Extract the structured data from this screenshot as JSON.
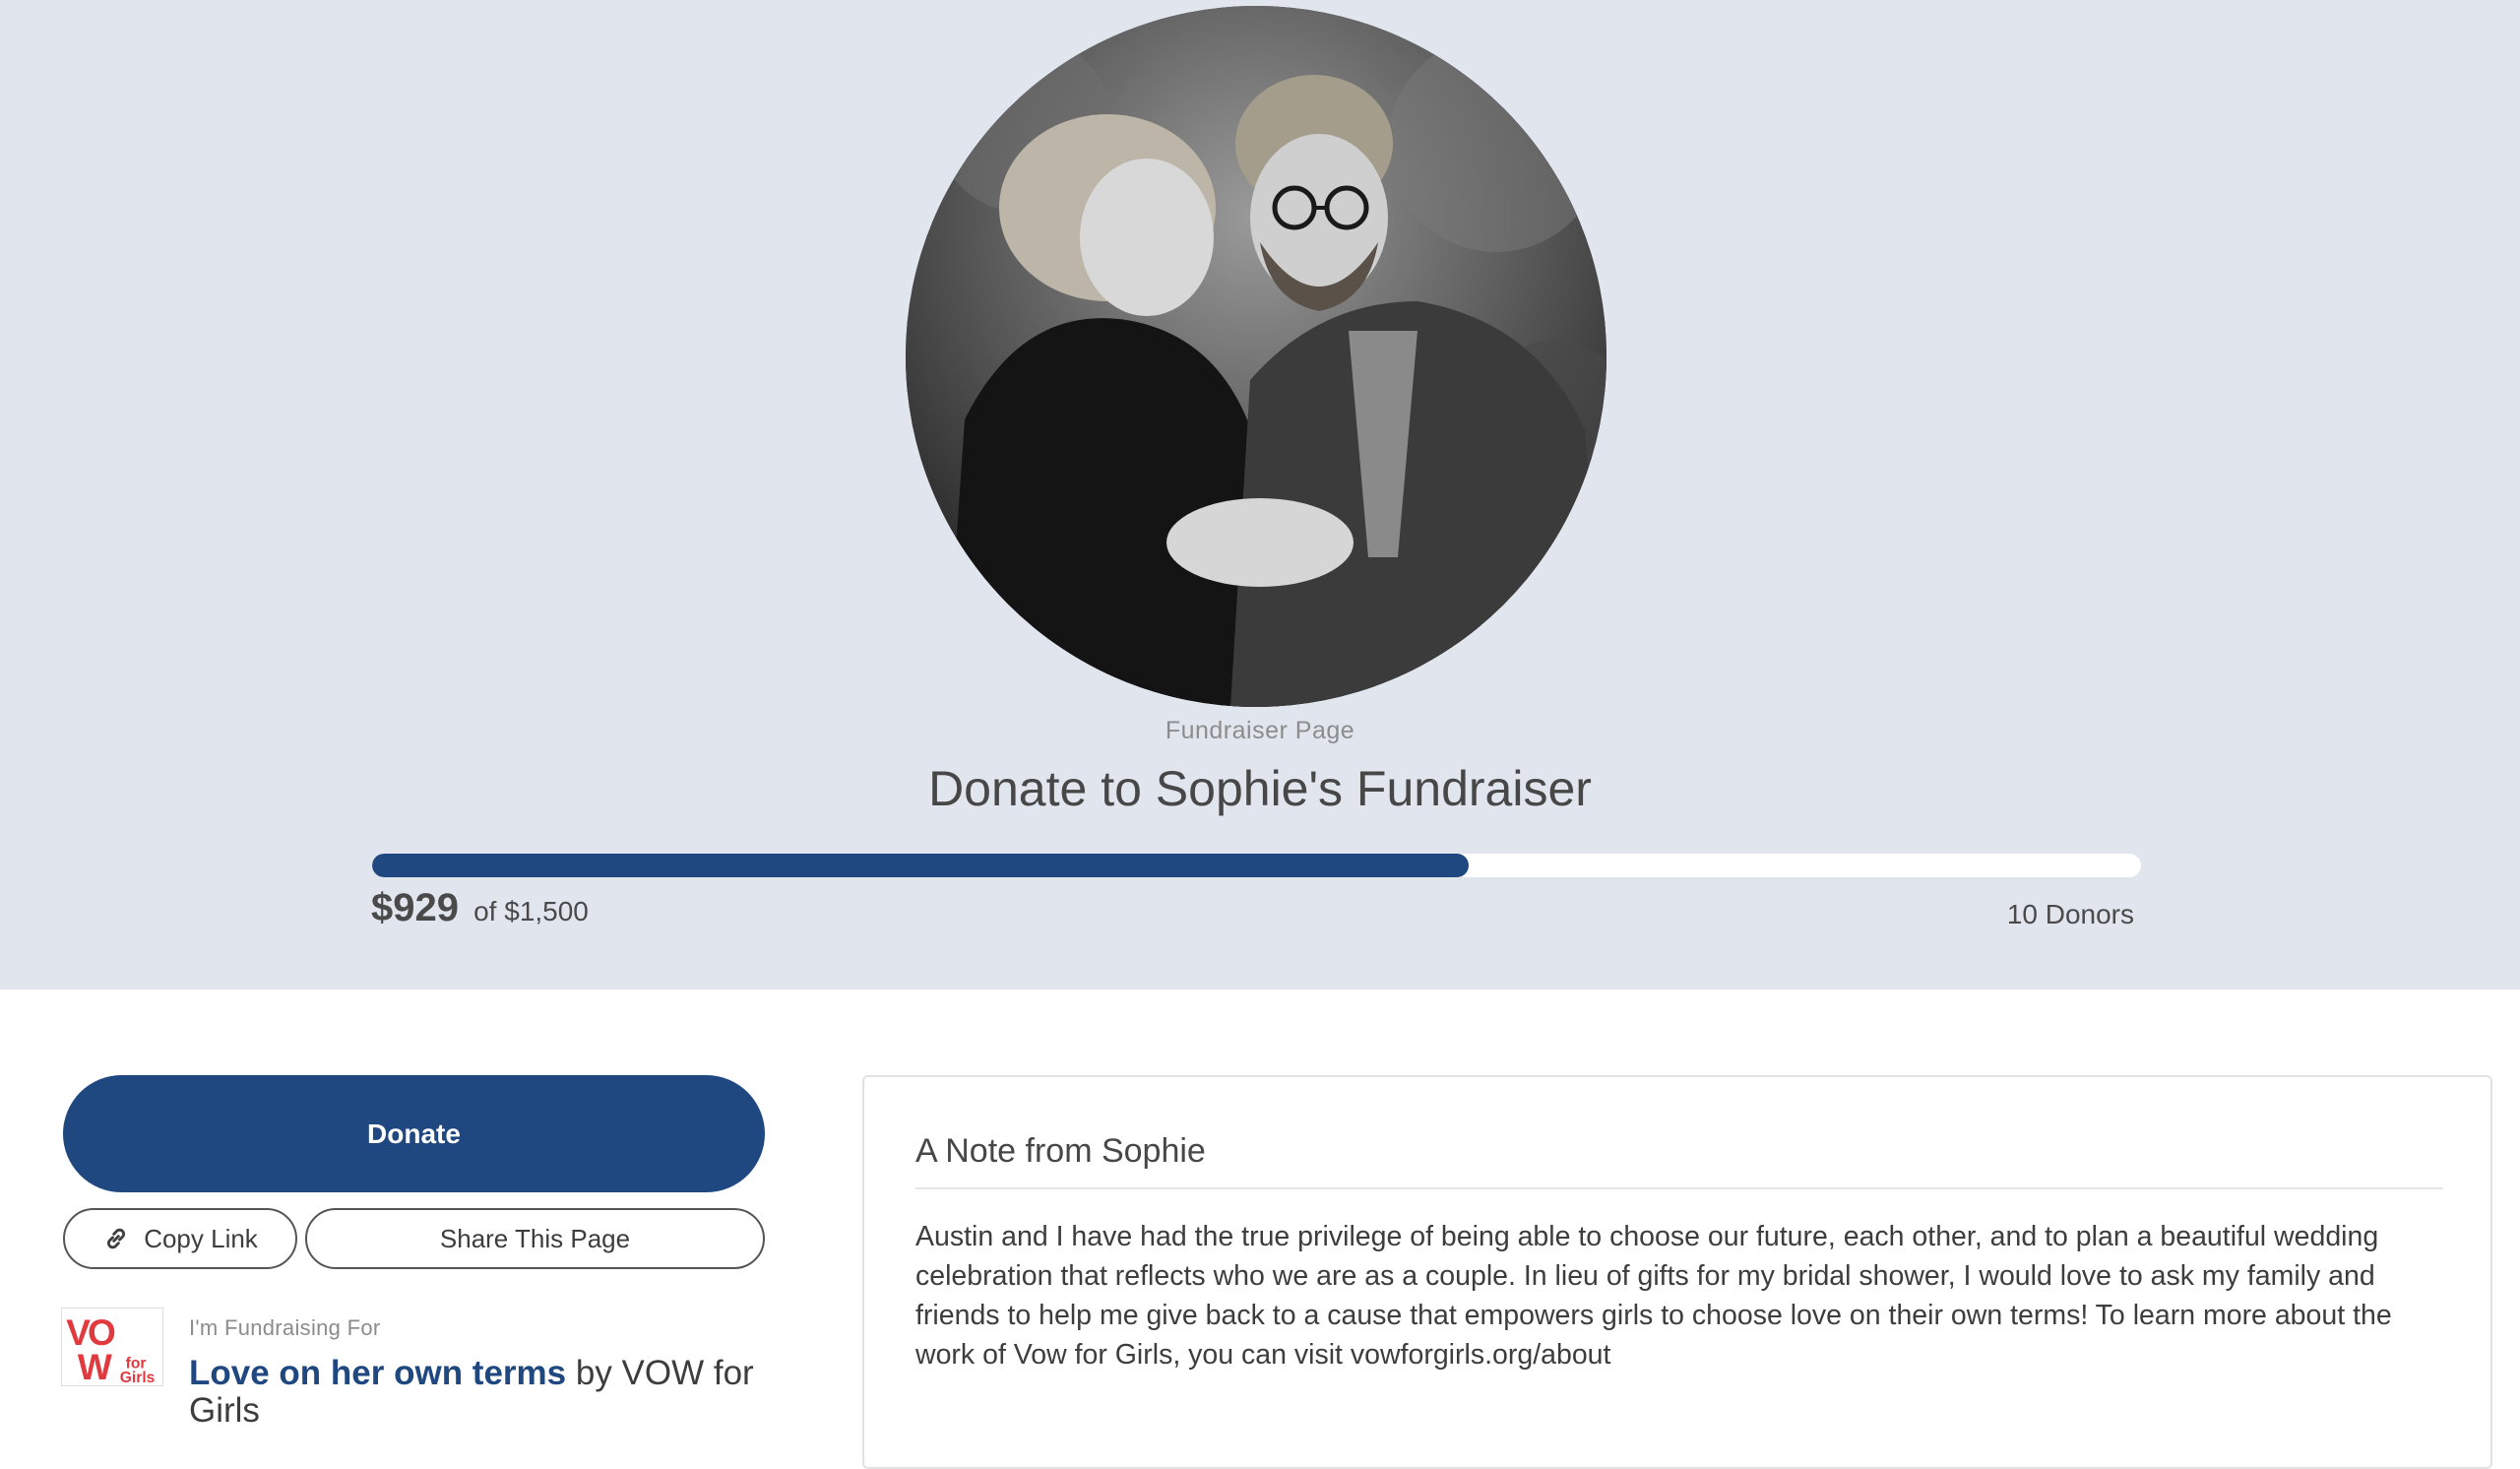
{
  "hero": {
    "eyebrow": "Fundraiser Page",
    "title": "Donate to Sophie's Fundraiser",
    "progress": {
      "raised": "$929",
      "goal_text": "of $1,500",
      "fraction": 0.62,
      "donors": "10 Donors"
    }
  },
  "actions": {
    "donate_label": "Donate",
    "copy_link_label": "Copy Link",
    "share_label": "Share This Page"
  },
  "charity": {
    "heading": "I'm Fundraising For",
    "campaign_name": "Love on her own terms",
    "by_text": " by VOW for Girls",
    "logo_text": "VOW for Girls"
  },
  "note": {
    "title": "A Note from Sophie",
    "body": "Austin and I have had the true privilege of being able to choose our future, each other, and to plan a beautiful wedding celebration that reflects who we are as a couple. In lieu of gifts for my bridal shower, I would love to ask my family and friends to help me give back to a cause that empowers girls to choose love on their own terms! To learn more about the work of Vow for Girls, you can visit vowforgirls.org/about"
  },
  "colors": {
    "hero_bg": "#e1e5ee",
    "brand_blue": "#1f4780",
    "logo_red": "#e0393e"
  }
}
